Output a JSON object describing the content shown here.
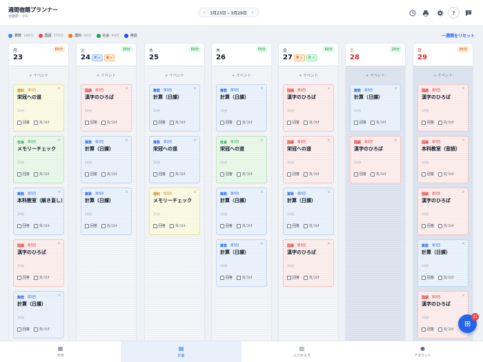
{
  "header": {
    "title": "週間宿題プランナー",
    "subtitle": "日能研・小5",
    "range_prev": "‹",
    "range_label": "3月23日 – 3月29日",
    "range_next": "›",
    "help_label": "?"
  },
  "legend": [
    {
      "subject": "算数",
      "minutes": "160分",
      "color": "#3b82f6"
    },
    {
      "subject": "国語",
      "minutes": "170分",
      "color": "#ef4444"
    },
    {
      "subject": "理科",
      "minutes": "40分",
      "color": "#f97316"
    },
    {
      "subject": "社会",
      "minutes": "40分",
      "color": "#16a34a"
    },
    {
      "subject": "英語",
      "minutes": "",
      "color": "#1d4ed8"
    }
  ],
  "reset_label": "一週間をリセット",
  "add_event_label": "+ イベント",
  "check_labels": {
    "answer": "回答",
    "mark": "丸つけ"
  },
  "days": [
    {
      "dow": "月",
      "date": "23",
      "minutes": "65分",
      "badge": "warn",
      "red": false,
      "chips": [],
      "cards": [
        {
          "type": "sci",
          "subject": "理科",
          "unit": "第5回",
          "title": "栄冠への道",
          "dash": "-",
          "min": "15分"
        },
        {
          "type": "soc",
          "subject": "社会",
          "unit": "第5回",
          "title": "メモリーチェック",
          "dash": "-",
          "min": "15分"
        },
        {
          "type": "math",
          "subject": "算数",
          "unit": "第5回",
          "title": "本科教室（解き直し）",
          "dash": "-",
          "min": "20分"
        },
        {
          "type": "jp",
          "subject": "国語",
          "unit": "第5回",
          "title": "漢字のひろば",
          "dash": "-",
          "min": "10分"
        },
        {
          "type": "math",
          "subject": "算数",
          "unit": "第5回",
          "title": "計算（日課）",
          "dash": "-",
          "min": "10分"
        }
      ]
    },
    {
      "dow": "火",
      "date": "24",
      "minutes": "30分",
      "badge": "ok",
      "red": false,
      "chips": [
        {
          "text": "英 ×",
          "color": "blue"
        },
        {
          "text": "書 ×",
          "color": "orange"
        }
      ],
      "cards": [
        {
          "type": "jp",
          "subject": "国語",
          "unit": "第5回",
          "title": "漢字のひろば",
          "dash": "-",
          "min": "10分"
        },
        {
          "type": "math",
          "subject": "算数",
          "unit": "第5回",
          "title": "計算（日課）",
          "dash": "-",
          "min": "10分"
        },
        {
          "type": "math",
          "subject": "算数",
          "unit": "第5回",
          "title": "計算（日課）",
          "dash": "-",
          "min": "10分"
        }
      ]
    },
    {
      "dow": "水",
      "date": "25",
      "minutes": "60分",
      "badge": "ok",
      "red": false,
      "chips": [],
      "cards": [
        {
          "type": "math",
          "subject": "算数",
          "unit": "第5回",
          "title": "計算（日課）",
          "dash": "-",
          "min": "10分"
        },
        {
          "type": "math",
          "subject": "算数",
          "unit": "第5回",
          "title": "栄冠への道",
          "dash": "-",
          "min": "20分"
        },
        {
          "type": "sci",
          "subject": "理科",
          "unit": "第5回",
          "title": "メモリーチェック",
          "dash": "-",
          "min": "15分"
        }
      ]
    },
    {
      "dow": "木",
      "date": "26",
      "minutes": "55分",
      "badge": "ok",
      "red": false,
      "chips": [],
      "cards": [
        {
          "type": "math",
          "subject": "算数",
          "unit": "第5回",
          "title": "計算（日課）",
          "dash": "-",
          "min": "10分"
        },
        {
          "type": "soc",
          "subject": "社会",
          "unit": "第5回",
          "title": "栄冠への道",
          "dash": "-",
          "min": "25分"
        },
        {
          "type": "math",
          "subject": "算数",
          "unit": "第5回",
          "title": "計算（日課）",
          "dash": "-",
          "min": "10分"
        },
        {
          "type": "math",
          "subject": "算数",
          "unit": "第5回",
          "title": "計算（日課）",
          "dash": "-",
          "min": "10分"
        }
      ]
    },
    {
      "dow": "金",
      "date": "27",
      "minutes": "60分",
      "badge": "ok",
      "red": false,
      "chips": [
        {
          "text": "算 ×",
          "color": "orange"
        },
        {
          "text": "社 ×",
          "color": "green"
        }
      ],
      "cards": [
        {
          "type": "jp",
          "subject": "国語",
          "unit": "第5回",
          "title": "漢字のひろば",
          "dash": "-",
          "min": "10分"
        },
        {
          "type": "jp",
          "subject": "国語",
          "unit": "第5回",
          "title": "栄冠への道",
          "dash": "-",
          "min": "30分"
        },
        {
          "type": "math",
          "subject": "算数",
          "unit": "第5回",
          "title": "計算（日課）",
          "dash": "-",
          "min": "10分"
        },
        {
          "type": "jp",
          "subject": "国語",
          "unit": "第5回",
          "title": "漢字のひろば",
          "dash": "-",
          "min": "10分"
        }
      ]
    },
    {
      "dow": "土",
      "date": "28",
      "minutes": "20分",
      "badge": "ok",
      "red": true,
      "chips": [],
      "cards": [
        {
          "type": "math",
          "subject": "算数",
          "unit": "第5回",
          "title": "計算（日課）",
          "dash": "-",
          "min": "10分"
        },
        {
          "type": "jp",
          "subject": "国語",
          "unit": "第5回",
          "title": "漢字のひろば",
          "dash": "-",
          "min": "10分"
        }
      ]
    },
    {
      "dow": "日",
      "date": "29",
      "minutes": "95分",
      "badge": "warn",
      "red": true,
      "chips": [],
      "cards": [
        {
          "type": "jp",
          "subject": "国語",
          "unit": "第5回",
          "title": "漢字のひろば",
          "dash": "-",
          "min": "10分"
        },
        {
          "type": "jp",
          "subject": "国語",
          "unit": "第5回",
          "title": "本科教室（音読）",
          "dash": "-",
          "min": "10分"
        },
        {
          "type": "jp",
          "subject": "国語",
          "unit": "第5回",
          "title": "漢字のひろば",
          "dash": "-",
          "min": "10分"
        },
        {
          "type": "math",
          "subject": "算数",
          "unit": "第5回",
          "title": "計算（日課）",
          "dash": "-",
          "min": "10分"
        },
        {
          "type": "jp",
          "subject": "国語",
          "unit": "第5回",
          "title": "漢字のひろば",
          "dash": "-",
          "min": "10分"
        }
      ]
    }
  ],
  "nav": [
    {
      "label": "今日",
      "icon": "calendar-icon",
      "glyph": "▦",
      "active": false
    },
    {
      "label": "計画",
      "icon": "document-icon",
      "glyph": "▤",
      "active": true
    },
    {
      "label": "ふりかえり",
      "icon": "bar-chart-icon",
      "glyph": "▥",
      "active": false
    },
    {
      "label": "アカウント",
      "icon": "person-icon",
      "glyph": "●",
      "active": false
    }
  ],
  "fab": {
    "glyph": "⊞",
    "badge": "31"
  }
}
